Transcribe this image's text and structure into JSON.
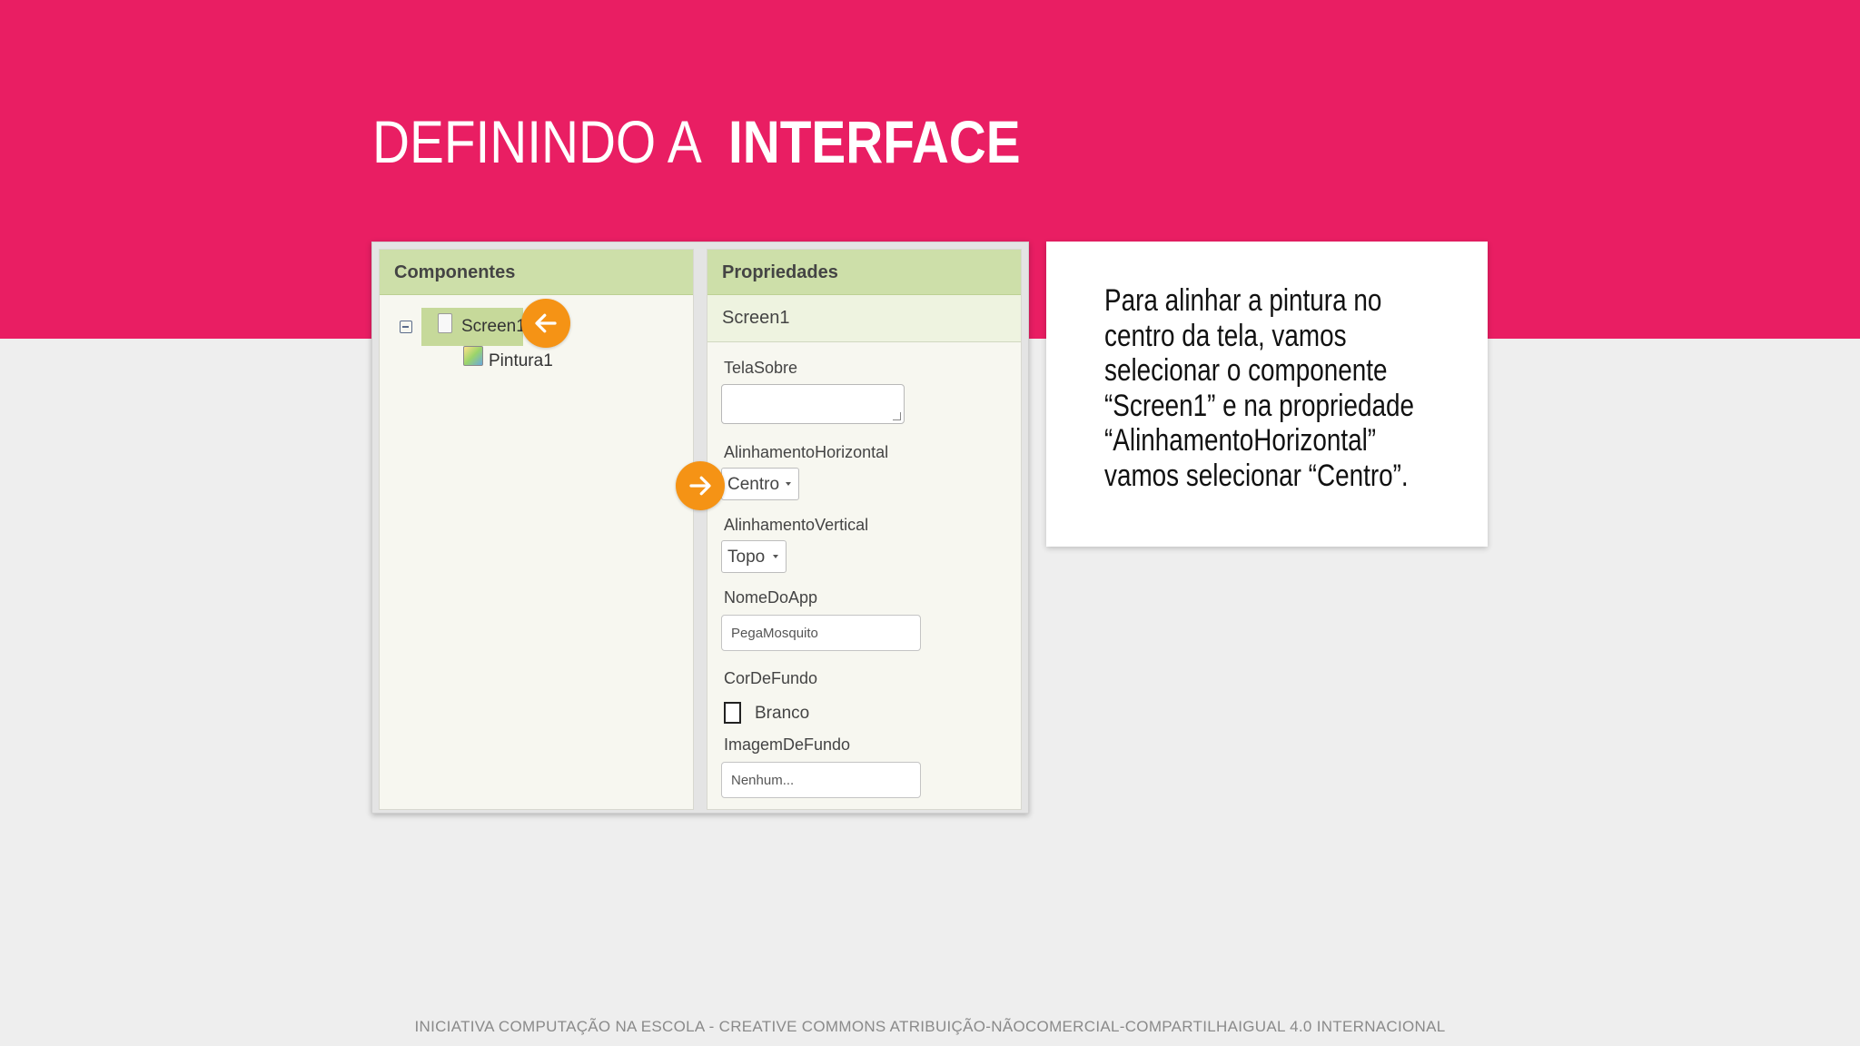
{
  "slide": {
    "title_light": "DEFININDO A ",
    "title_bold": "INTERFACE",
    "footer": "INICIATIVA COMPUTAÇÃO NA ESCOLA - CREATIVE COMMONS ATRIBUIÇÃO-NÃOCOMERCIAL-COMPARTILHAIGUAL 4.0 INTERNACIONAL"
  },
  "components_panel": {
    "header": "Componentes",
    "items": [
      {
        "label": "Screen1",
        "icon": "screen-icon",
        "selected": true
      },
      {
        "label": "Pintura1",
        "icon": "canvas-icon",
        "selected": false
      }
    ]
  },
  "properties_panel": {
    "header": "Propriedades",
    "component": "Screen1",
    "props": {
      "tela_sobre": {
        "label": "TelaSobre",
        "value": ""
      },
      "alinhamento_horizontal": {
        "label": "AlinhamentoHorizontal",
        "value": "Centro"
      },
      "alinhamento_vertical": {
        "label": "AlinhamentoVertical",
        "value": "Topo"
      },
      "nome_do_app": {
        "label": "NomeDoApp",
        "value": "PegaMosquito"
      },
      "cor_de_fundo": {
        "label": "CorDeFundo",
        "value": "Branco"
      },
      "imagem_de_fundo": {
        "label": "ImagemDeFundo",
        "value": "Nenhum..."
      }
    }
  },
  "note": {
    "text": "Para alinhar a pintura no\ncentro da tela, vamos\nselecionar o componente\n“Screen1” e na propriedade\n“AlinhamentoHorizontal”\nvamos selecionar “Centro”."
  },
  "colors": {
    "header_band": "#e91e63",
    "background": "#eeeeee",
    "panel_header": "#cddfa9",
    "arrow_marker": "#f59315"
  }
}
